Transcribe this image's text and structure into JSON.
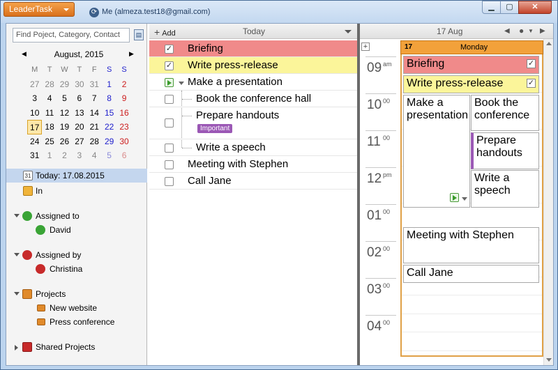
{
  "app": {
    "title": "LeaderTask",
    "account": "Me (almeza.test18@gmail.com)"
  },
  "window": {
    "minimize": "▁",
    "maximize": "▢",
    "close": "✕"
  },
  "sidebar": {
    "search_placeholder": "Find Poject, Category, Contact",
    "calendar": {
      "month": "August, 2015",
      "prev": "◀",
      "next": "▶",
      "weekdays": [
        "M",
        "T",
        "W",
        "T",
        "F",
        "S",
        "S"
      ],
      "weeks": [
        [
          "27",
          "28",
          "29",
          "30",
          "31",
          "1",
          "2"
        ],
        [
          "3",
          "4",
          "5",
          "6",
          "7",
          "8",
          "9"
        ],
        [
          "10",
          "11",
          "12",
          "13",
          "14",
          "15",
          "16"
        ],
        [
          "17",
          "18",
          "19",
          "20",
          "21",
          "22",
          "23"
        ],
        [
          "24",
          "25",
          "26",
          "27",
          "28",
          "29",
          "30"
        ],
        [
          "31",
          "1",
          "2",
          "3",
          "4",
          "5",
          "6"
        ]
      ],
      "selected": "17"
    },
    "today": "Today: 17.08.2015",
    "in": "In",
    "assigned_to": "Assigned to",
    "assigned_to_person": "David",
    "assigned_by": "Assigned by",
    "assigned_by_person": "Christina",
    "projects": "Projects",
    "project_items": [
      "New website",
      "Press conference"
    ],
    "shared_projects": "Shared Projects"
  },
  "list": {
    "add": "Add",
    "title": "Today",
    "tasks": [
      {
        "label": "Briefing",
        "checked": true,
        "color": "#f08a8a"
      },
      {
        "label": "Write press-release",
        "checked": true,
        "color": "#fbf59a"
      },
      {
        "label": "Make a presentation",
        "checked": false
      },
      {
        "label": "Book the conference hall",
        "checked": false
      },
      {
        "label": "Prepare handouts",
        "checked": false,
        "badge": "Important"
      },
      {
        "label": "Write a speech",
        "checked": false
      },
      {
        "label": "Meeting with Stephen",
        "checked": false
      },
      {
        "label": "Call Jane",
        "checked": false
      }
    ]
  },
  "dayview": {
    "date": "17 Aug",
    "day_number": "17",
    "day_name": "Monday",
    "expand": "+",
    "hours": [
      {
        "h": "09",
        "ap": "am"
      },
      {
        "h": "10",
        "ap": "00"
      },
      {
        "h": "11",
        "ap": "00"
      },
      {
        "h": "12",
        "ap": "pm"
      },
      {
        "h": "01",
        "ap": "00"
      },
      {
        "h": "02",
        "ap": "00"
      },
      {
        "h": "03",
        "ap": "00"
      },
      {
        "h": "04",
        "ap": "00"
      }
    ],
    "events": {
      "briefing": "Briefing",
      "press": "Write press-release",
      "presentation": "Make a presentation",
      "conference": "Book the conference",
      "handouts": "Prepare handouts",
      "speech": "Write a speech",
      "meeting": "Meeting with Stephen",
      "call": "Call Jane"
    }
  },
  "colors": {
    "accent": "#f2a13a",
    "brand": "#d9701b",
    "briefing": "#f08a8a",
    "press": "#fbf59a",
    "important": "#9b58b5"
  }
}
